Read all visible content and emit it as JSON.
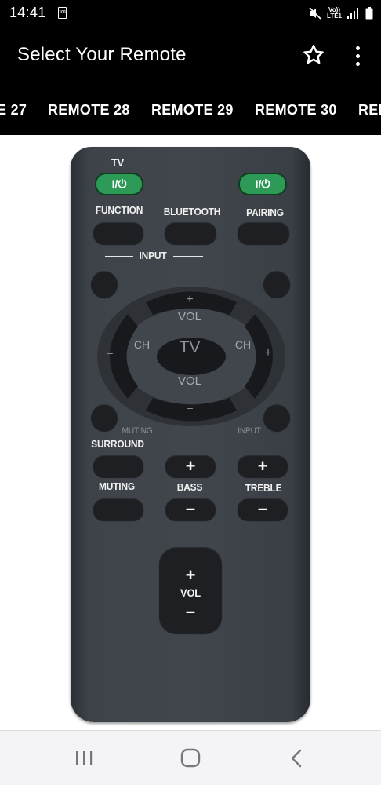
{
  "status_bar": {
    "time": "14:41",
    "battery_notification": "100",
    "network_label_top": "Vo))",
    "network_label_bottom": "LTE1"
  },
  "app_bar": {
    "title": "Select Your Remote",
    "star_icon": "star-outline-icon",
    "menu_icon": "more-vert-icon"
  },
  "tabs": [
    {
      "label": "E 27"
    },
    {
      "label": "REMOTE 28"
    },
    {
      "label": "REMOTE 29"
    },
    {
      "label": "REMOTE 30"
    },
    {
      "label": "REM"
    }
  ],
  "remote": {
    "tv_label": "TV",
    "power_left": "I/⏻",
    "power_right": "I/⏻",
    "function_label": "FUNCTION",
    "bluetooth_label": "BLUETOOTH",
    "pairing_label": "PAIRING",
    "input_label": "INPUT",
    "dpad": {
      "up_plus": "+",
      "vol_top": "VOL",
      "ch_left": "CH",
      "minus_left": "–",
      "center": "TV",
      "ch_right": "CH",
      "plus_right": "+",
      "vol_bottom": "VOL",
      "down_minus": "–"
    },
    "muting_small_label": "MUTING",
    "surround_label": "SURROUND",
    "input_right_label": "INPUT",
    "muting_label": "MUTING",
    "bass_label": "BASS",
    "treble_label": "TREBLE",
    "bass_plus": "+",
    "bass_minus": "–",
    "treble_plus": "+",
    "treble_minus": "–",
    "vol_plus": "+",
    "vol_label": "VOL",
    "vol_minus": "–"
  },
  "colors": {
    "app_bar": "#000000",
    "remote_body": "#41464d",
    "power_green": "#2e9a57"
  }
}
